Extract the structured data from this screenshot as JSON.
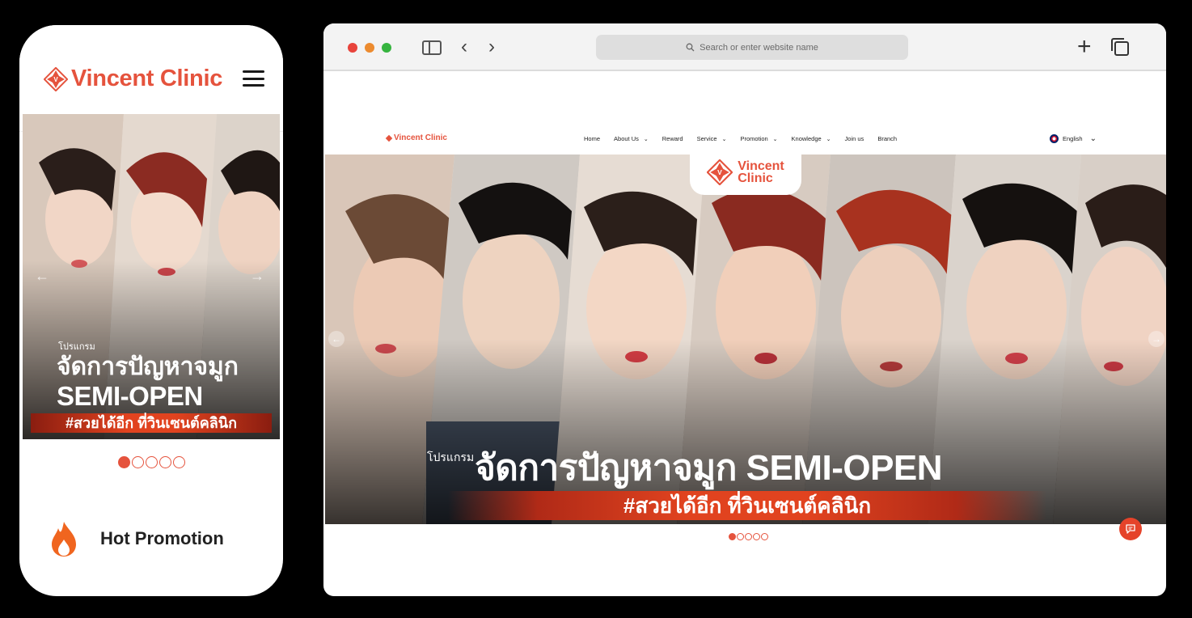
{
  "mobile": {
    "brand": "Vincent Clinic",
    "banner": {
      "small_text": "โปรแกรม",
      "title_line1": "จัดการปัญหาจมูก",
      "title_line2": "SEMI-OPEN",
      "ribbon": "#สวยได้อีก ที่วินเซนต์คลินิก"
    },
    "carousel": {
      "count": 5,
      "active_index": 0
    },
    "section_title": "Hot Promotion"
  },
  "browser": {
    "address_placeholder": "Search or enter website name",
    "site": {
      "brand": "Vincent Clinic",
      "nav": [
        {
          "label": "Home",
          "dropdown": false
        },
        {
          "label": "About Us",
          "dropdown": true
        },
        {
          "label": "Reward",
          "dropdown": false
        },
        {
          "label": "Service",
          "dropdown": true
        },
        {
          "label": "Promotion",
          "dropdown": true
        },
        {
          "label": "Knowledge",
          "dropdown": true
        },
        {
          "label": "Join us",
          "dropdown": false
        },
        {
          "label": "Branch",
          "dropdown": false
        }
      ],
      "language": "English"
    },
    "hero": {
      "logo_line1": "Vincent",
      "logo_line2": "Clinic",
      "small_text": "โปรแกรม",
      "title": "จัดการปัญหาจมูก SEMI-OPEN",
      "ribbon": "#สวยได้อีก ที่วินเซนต์คลินิก"
    },
    "carousel": {
      "count": 5,
      "active_index": 0
    }
  },
  "colors": {
    "brand_orange": "#e5533d",
    "ribbon_red": "#e1431f",
    "chat_button": "#e5432a"
  },
  "icons": [
    "hamburger-menu-icon",
    "flame-icon",
    "sidebar-toggle-icon",
    "back-arrow-icon",
    "forward-arrow-icon",
    "search-icon",
    "new-tab-plus-icon",
    "tabs-overview-icon",
    "uk-flag-icon",
    "chat-icon",
    "carousel-prev-icon",
    "carousel-next-icon"
  ]
}
